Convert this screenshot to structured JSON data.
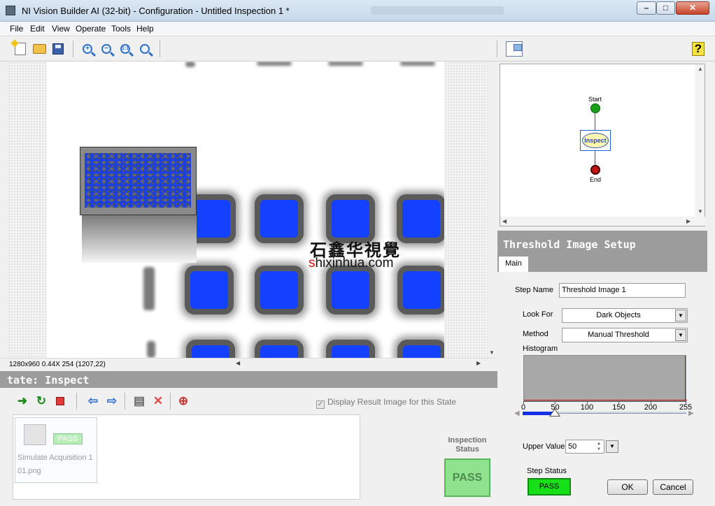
{
  "window": {
    "title": "NI Vision Builder AI (32-bit) - Configuration - Untitled Inspection 1 *",
    "min_label": "–",
    "max_label": "□",
    "close_label": "✕"
  },
  "menu": [
    "File",
    "Edit",
    "View",
    "Operate",
    "Tools",
    "Help"
  ],
  "toolbar": {
    "zoom_actual_label": "1:1",
    "help_label": "?"
  },
  "viewer": {
    "watermark_cn": "石鑫华視覺",
    "watermark_en_s": "s",
    "watermark_en_rest": "hixinhua.com",
    "status": "1280x960 0.44X 254    (1207,22)"
  },
  "state": {
    "header": "tate:  Inspect",
    "display_result_label": "Display Result Image for this State",
    "display_result_checked": true,
    "steps": [
      {
        "name": "Simulate Acquisition 1",
        "file": "01.png",
        "status": "PASS"
      }
    ],
    "inspection_status_label": "Inspection Status",
    "inspection_status": "PASS"
  },
  "flowchart": {
    "start_label": "Start",
    "inspect_label": "Inspect",
    "end_label": "End"
  },
  "setup": {
    "title": "Threshold Image Setup",
    "tab_main": "Main",
    "step_name_label": "Step Name",
    "step_name_value": "Threshold Image 1",
    "look_for_label": "Look For",
    "look_for_value": "Dark Objects",
    "method_label": "Method",
    "method_value": "Manual Threshold",
    "histogram_label": "Histogram",
    "histogram_ticks": [
      "0",
      "50",
      "100",
      "150",
      "200",
      "255"
    ],
    "threshold_range": [
      0,
      50
    ],
    "upper_value_label": "Upper Value",
    "upper_value": "50",
    "step_status_label": "Step Status",
    "step_status": "PASS",
    "ok_label": "OK",
    "cancel_label": "Cancel"
  },
  "colors": {
    "threshold_overlay": "#1440ff",
    "pass_green": "#18e018",
    "panel_header_gray": "#9c9c9c"
  }
}
